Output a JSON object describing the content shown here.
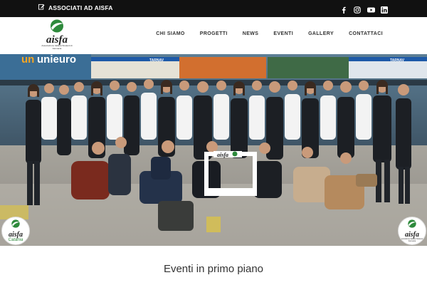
{
  "topbar": {
    "associati_label": "ASSOCIATI AD AISFA",
    "icons": [
      "edit-icon",
      "facebook-icon",
      "instagram-icon",
      "youtube-icon",
      "linkedin-icon"
    ]
  },
  "header": {
    "logo_text": "aisfa",
    "logo_tagline": "Associazione Italiana Studenti di Farmacia",
    "nav": [
      "CHI SIAMO",
      "PROGETTI",
      "NEWS",
      "EVENTI",
      "GALLERY",
      "CONTATTACI"
    ]
  },
  "hero": {
    "left_logo_text": "aisfa",
    "left_logo_sub": "Catania",
    "right_logo_text": "aisfa",
    "right_logo_sub": "Associazione Italiana Studenti di Farmacia",
    "frame_text": "aisfa",
    "signs": [
      "unieuro",
      "TARNAV",
      "TARNAV"
    ]
  },
  "section": {
    "title": "Eventi in primo piano"
  },
  "colors": {
    "topbar_bg": "#111111",
    "logo_green": "#2e8a3c",
    "nav_text": "#333333"
  }
}
